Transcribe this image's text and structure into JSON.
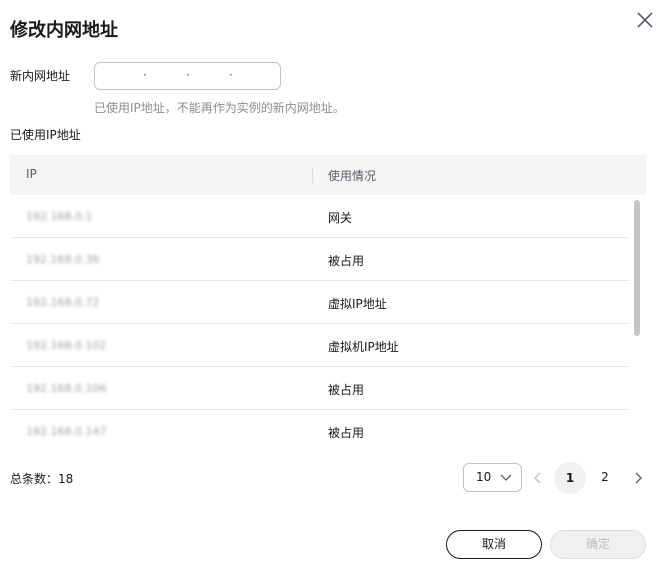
{
  "dialog": {
    "title": "修改内网地址",
    "close_icon": "close-icon"
  },
  "form": {
    "new_ip_label": "新内网地址",
    "ip_separator": "·",
    "hint": "已使用IP地址，不能再作为实例的新内网地址。",
    "used_ip_label": "已使用IP地址"
  },
  "table": {
    "columns": [
      "IP",
      "使用情况"
    ],
    "rows": [
      {
        "ip": "192.168.0.1",
        "usage": "网关"
      },
      {
        "ip": "192.168.0.36",
        "usage": "被占用"
      },
      {
        "ip": "192.168.0.72",
        "usage": "虚拟IP地址"
      },
      {
        "ip": "192.168.0.102",
        "usage": "虚拟机IP地址"
      },
      {
        "ip": "192.168.0.106",
        "usage": "被占用"
      },
      {
        "ip": "192.168.0.147",
        "usage": "被占用"
      }
    ]
  },
  "pagination": {
    "total": "总条数：18",
    "page_size": "10",
    "pages": [
      "1",
      "2"
    ],
    "current_page": "1"
  },
  "footer": {
    "cancel": "取消",
    "confirm": "确定"
  }
}
